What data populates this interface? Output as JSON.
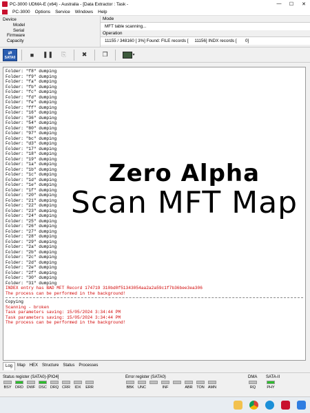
{
  "window": {
    "title": "PC-3000 UDMA-E (x64) - Australia - [Data Extractor : Task -"
  },
  "menu": {
    "app_label": "PC-3000",
    "items": [
      "Options",
      "Service",
      "Windows",
      "Help"
    ]
  },
  "device": {
    "header": "Device",
    "fields": [
      "Model",
      "Serial",
      "Firmware",
      "Capacity"
    ]
  },
  "mode": {
    "header": "Mode",
    "value": "MFT table scanning..."
  },
  "operation": {
    "header": "Operation",
    "value": "11155 / 348160 [ 3%] Found: FILE records [     11156] INDX records [       0]"
  },
  "toolbar": {
    "sata_label": "SATA0"
  },
  "log": {
    "folder_lines": [
      "Folder: \"f8\" dumping",
      "Folder: \"f9\" dumping",
      "Folder: \"fa\" dumping",
      "Folder: \"fb\" dumping",
      "Folder: \"fc\" dumping",
      "Folder: \"fd\" dumping",
      "Folder: \"fe\" dumping",
      "Folder: \"ff\" dumping",
      "Folder: \"16\" dumping",
      "Folder: \"36\" dumping",
      "Folder: \"54\" dumping",
      "Folder: \"80\" dumping",
      "Folder: \"97\" dumping",
      "Folder: \"bc\" dumping",
      "Folder: \"d3\" dumping",
      "Folder: \"17\" dumping",
      "Folder: \"18\" dumping",
      "Folder: \"19\" dumping",
      "Folder: \"1a\" dumping",
      "Folder: \"1b\" dumping",
      "Folder: \"1c\" dumping",
      "Folder: \"1d\" dumping",
      "Folder: \"1e\" dumping",
      "Folder: \"1f\" dumping",
      "Folder: \"20\" dumping",
      "Folder: \"21\" dumping",
      "Folder: \"22\" dumping",
      "Folder: \"23\" dumping",
      "Folder: \"24\" dumping",
      "Folder: \"25\" dumping",
      "Folder: \"26\" dumping",
      "Folder: \"27\" dumping",
      "Folder: \"28\" dumping",
      "Folder: \"29\" dumping",
      "Folder: \"2a\" dumping",
      "Folder: \"2b\" dumping",
      "Folder: \"2c\" dumping",
      "Folder: \"2d\" dumping",
      "Folder: \"2e\" dumping",
      "Folder: \"2f\" dumping",
      "Folder: \"30\" dumping",
      "Folder: \"31\" dumping"
    ],
    "error_line": "INDEX entry has BAD MFT Record 174719 310bd0f51343054aa2a2a59c1f7b36bee3ea306",
    "bg_line_1": "The process can be performed in the background!",
    "copying": "Copying",
    "scanning": "Scanning - broken",
    "saving_1": "Task parameters saving: 15/05/2024 3:34:44 PM",
    "saving_2": "Task parameters saving: 15/05/2024 3:34:44 PM",
    "bg_line_2": "The process can be performed in the background!"
  },
  "watermark": {
    "title": "Zero Alpha",
    "subtitle": "Scan MFT Map"
  },
  "tabs": [
    "Log",
    "Map",
    "HEX",
    "Structure",
    "Status",
    "Processes"
  ],
  "status": {
    "status_register": {
      "title": "Status register (SATA0)-[PIO4]",
      "leds": [
        {
          "label": "BSY",
          "on": false
        },
        {
          "label": "DRD",
          "on": true
        },
        {
          "label": "DWF",
          "on": false
        },
        {
          "label": "DSC",
          "on": true
        },
        {
          "label": "DRQ",
          "on": false
        },
        {
          "label": "CRR",
          "on": false
        },
        {
          "label": "IDX",
          "on": false
        },
        {
          "label": "ERR",
          "on": false
        }
      ]
    },
    "error_register": {
      "title": "Error register (SATA0)",
      "leds": [
        {
          "label": "BBK",
          "on": false
        },
        {
          "label": "UNC",
          "on": false
        },
        {
          "label": "",
          "on": false
        },
        {
          "label": "INF",
          "on": false
        },
        {
          "label": "",
          "on": false
        },
        {
          "label": "ABR",
          "on": false
        },
        {
          "label": "TON",
          "on": false
        },
        {
          "label": "AMN",
          "on": false
        }
      ]
    },
    "dma": {
      "title": "DMA",
      "leds": [
        {
          "label": "RQ",
          "on": false
        }
      ]
    },
    "sata2": {
      "title": "SATA-II",
      "leds": [
        {
          "label": "PHY",
          "on": true
        }
      ]
    }
  },
  "colors": {
    "led_on": "#2dbe2d",
    "error_text": "#d00000",
    "sata_button": "#2a5db0"
  }
}
